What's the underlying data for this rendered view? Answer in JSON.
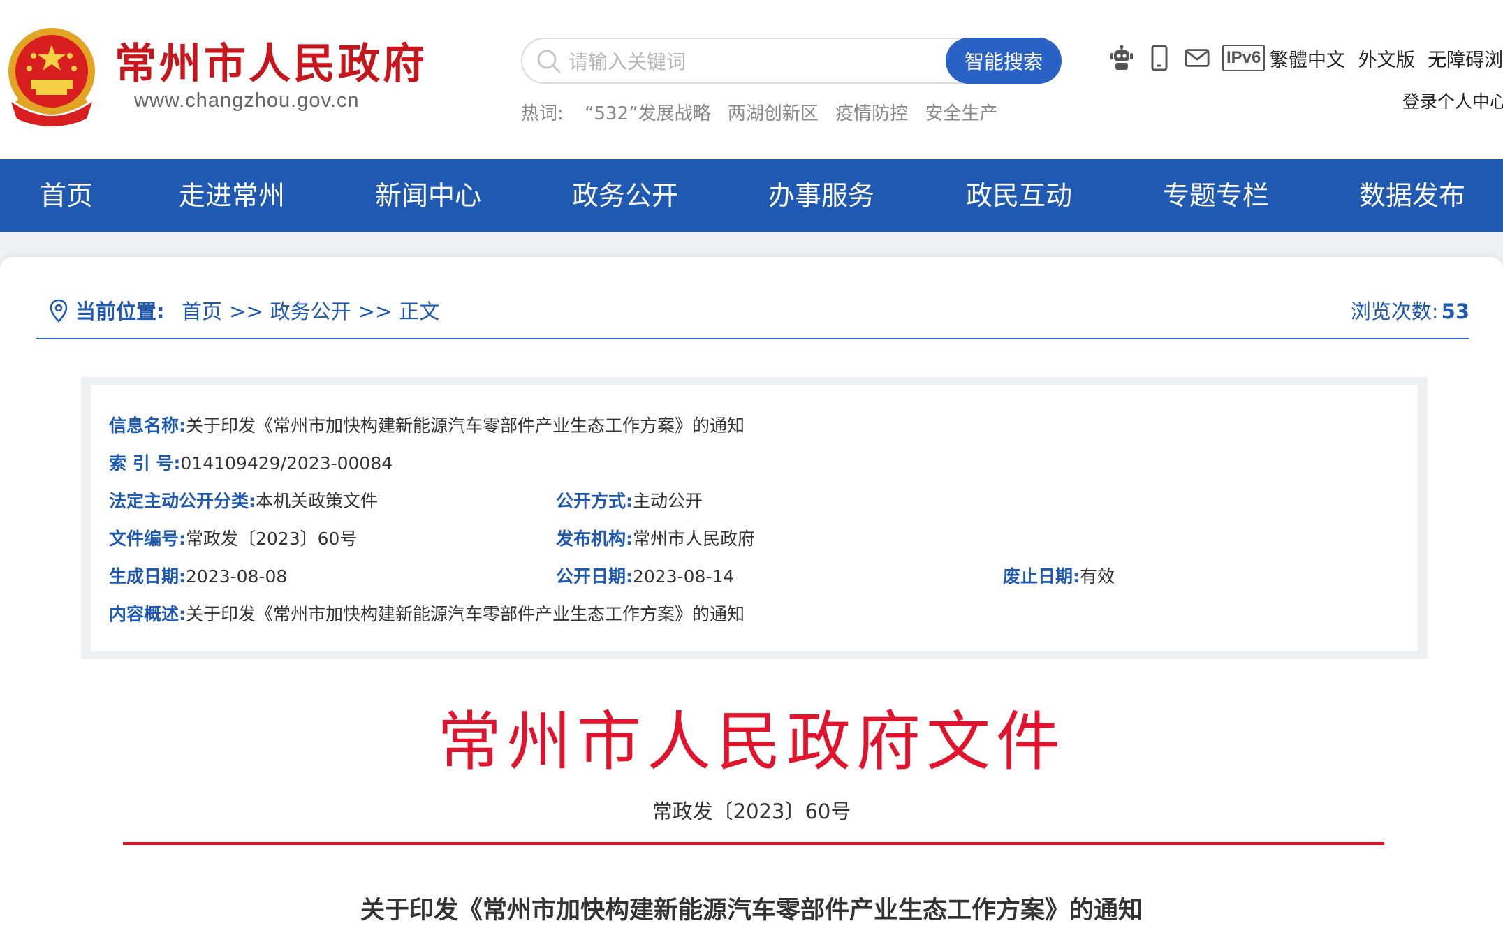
{
  "header": {
    "site_name": "常州市人民政府",
    "site_url": "www.changzhou.gov.cn",
    "search": {
      "placeholder": "请输入关键词",
      "button_label": "智能搜索"
    },
    "hotwords": {
      "label": "热词:",
      "items": [
        "“532”发展战略",
        "两湖创新区",
        "疫情防控",
        "安全生产"
      ]
    },
    "tool_icons": [
      "robot-icon",
      "mobile-icon",
      "mail-icon",
      "ipv6-badge"
    ],
    "ipv6_label": "IPv6",
    "top_links": [
      "繁體中文",
      "外文版",
      "无障碍浏览"
    ],
    "login_label": "登录个人中心"
  },
  "nav": {
    "items": [
      "首页",
      "走进常州",
      "新闻中心",
      "政务公开",
      "办事服务",
      "政民互动",
      "专题专栏",
      "数据发布"
    ]
  },
  "breadcrumb": {
    "label": "当前位置:",
    "trail": [
      "首页",
      "政务公开",
      "正文"
    ],
    "separator": ">>",
    "views_label": "浏览次数:",
    "views_count": "53"
  },
  "info": {
    "name_key": "信息名称:",
    "name_val": "关于印发《常州市加快构建新能源汽车零部件产业生态工作方案》的通知",
    "index_key": "索 引 号:",
    "index_val": "014109429/2023-00084",
    "category_key": "法定主动公开分类:",
    "category_val": "本机关政策文件",
    "method_key": "公开方式:",
    "method_val": "主动公开",
    "docno_key": "文件编号:",
    "docno_val": "常政发〔2023〕60号",
    "publisher_key": "发布机构:",
    "publisher_val": "常州市人民政府",
    "created_key": "生成日期:",
    "created_val": "2023-08-08",
    "published_key": "公开日期:",
    "published_val": "2023-08-14",
    "expiry_key": "废止日期:",
    "expiry_val": "有效",
    "summary_key": "内容概述:",
    "summary_val": "关于印发《常州市加快构建新能源汽车零部件产业生态工作方案》的通知"
  },
  "document": {
    "title": "常州市人民政府文件",
    "number": "常政发〔2023〕60号",
    "subject": "关于印发《常州市加快构建新能源汽车零部件产业生态工作方案》的通知"
  },
  "colors": {
    "brand_blue": "#1f59b1",
    "brand_red": "#c8161d",
    "doc_red": "#e0142d"
  }
}
